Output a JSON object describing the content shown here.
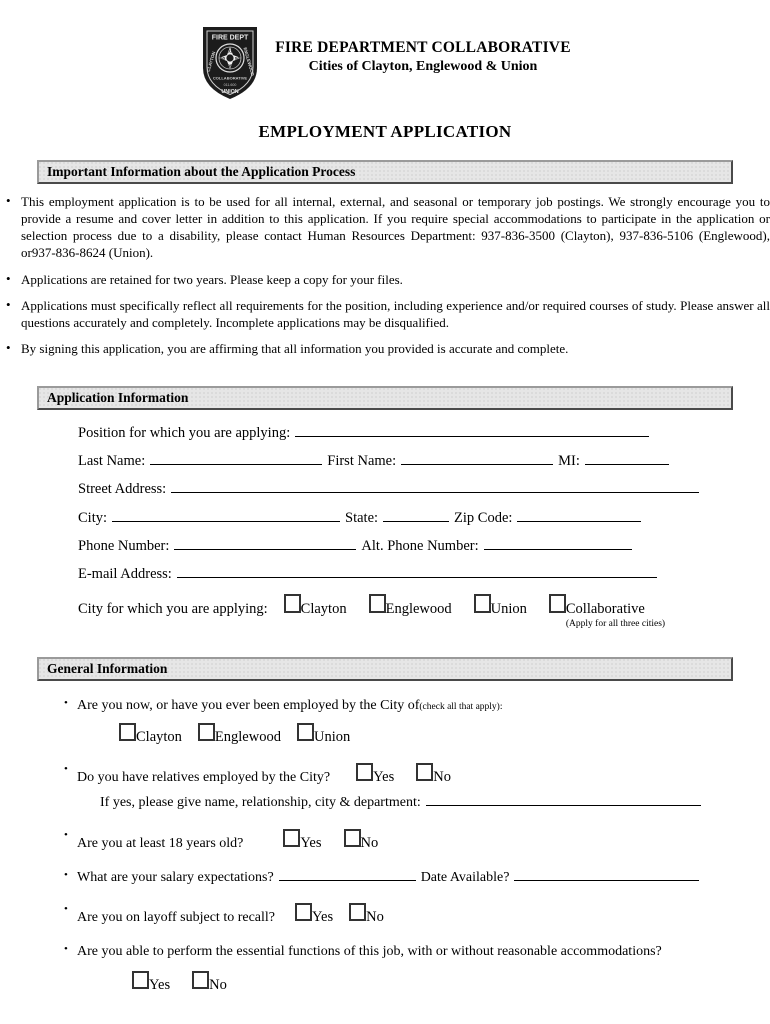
{
  "header": {
    "badge_icon": "fire-department-badge",
    "badge_text_top": "FIRE DEPT",
    "badge_text_bottom": "UNION",
    "org_name": "FIRE DEPARTMENT COLLABORATIVE",
    "org_subtitle": "Cities of Clayton, Englewood & Union",
    "document_title": "EMPLOYMENT APPLICATION"
  },
  "important_info": {
    "section_title": "Important Information about the Application Process",
    "bullets": [
      "This employment application is to be used for all internal, external, and seasonal or temporary job postings.  We strongly encourage you to provide a resume and cover letter in addition to this application.  If you require special accommodations to participate in the application or selection process due to a disability, please contact Human Resources Department: 937-836-3500 (Clayton), 937-836-5106 (Englewood), or937-836-8624 (Union).",
      "Applications are retained for two years.  Please keep a copy for your files.",
      "Applications must specifically reflect all requirements for the position, including experience and/or required courses of study.  Please answer all questions accurately and completely.  Incomplete applications may be disqualified.",
      "By signing this application, you are affirming that all information you provided is accurate and complete."
    ]
  },
  "application_info": {
    "section_title": "Application Information",
    "position_label": "Position for which you are applying:",
    "last_name_label": "Last Name:",
    "first_name_label": "First Name:",
    "mi_label": "MI:",
    "street_label": "Street Address:",
    "city_label": "City:",
    "state_label": "State:",
    "zip_label": "Zip Code:",
    "phone_label": "Phone Number:",
    "alt_phone_label": "Alt. Phone Number:",
    "email_label": "E-mail Address:",
    "city_applying_label": "City for which you are applying:",
    "city_options": [
      "Clayton",
      "Englewood",
      "Union",
      "Collaborative"
    ],
    "collaborative_note": "(Apply for all three cities)",
    "values": {
      "position": "",
      "last_name": "",
      "first_name": "",
      "mi": "",
      "street": "",
      "city": "",
      "state": "",
      "zip": "",
      "phone": "",
      "alt_phone": "",
      "email": ""
    }
  },
  "general_info": {
    "section_title": "General Information",
    "q_employed": "Are you now, or have you ever been employed by the City of",
    "q_employed_note": "(check all that apply):",
    "employed_options": [
      "Clayton",
      "Englewood",
      "Union"
    ],
    "q_relatives": "Do you have relatives employed by the City?",
    "relatives_options": [
      "Yes",
      "No"
    ],
    "relatives_followup": "If yes, please give name, relationship, city & department:",
    "q_age": "Are you at least 18 years old?",
    "age_options": [
      "Yes",
      "No"
    ],
    "q_salary": "What are your salary expectations?",
    "q_date_available": "Date Available?",
    "q_layoff": "Are you on layoff subject to recall?",
    "layoff_options": [
      "Yes",
      "No"
    ],
    "q_essential": "Are you able to perform the essential functions of this job, with or without reasonable accommodations?",
    "essential_options": [
      "Yes",
      "No"
    ],
    "values": {
      "relatives_detail": "",
      "salary": "",
      "date_available": ""
    }
  }
}
